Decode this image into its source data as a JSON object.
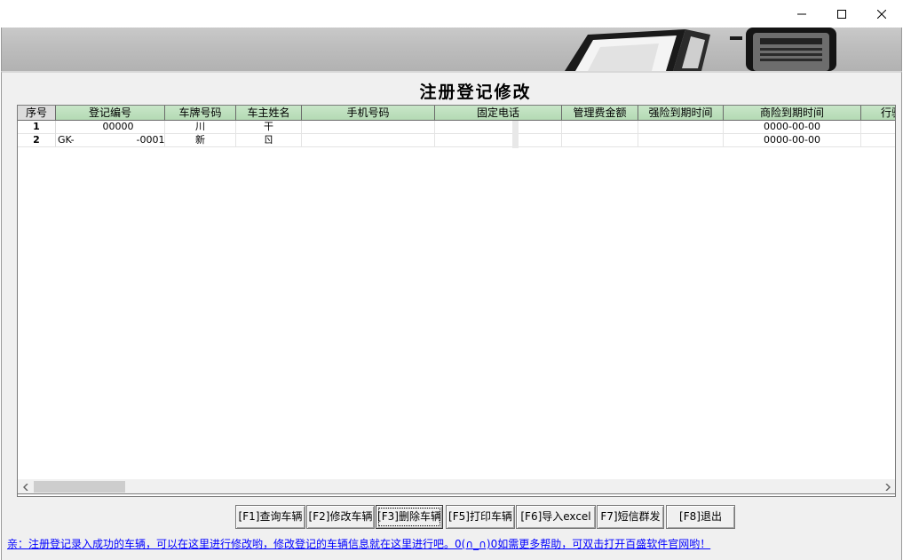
{
  "window": {
    "controls": {
      "minimize_icon": "minimize-icon",
      "maximize_icon": "maximize-icon",
      "close_icon": "close-icon"
    }
  },
  "main": {
    "title": "注册登记修改"
  },
  "table": {
    "columns": [
      "序号",
      "登记编号",
      "车牌号码",
      "车主姓名",
      "手机号码",
      "固定电话",
      "管理费金额",
      "强险到期时间",
      "商险到期时间",
      "行驶"
    ],
    "rows": [
      {
        "seq": "1",
        "reg_no": "00000",
        "plate": "川",
        "owner": "干",
        "mobile": "",
        "phone": "",
        "fee": "",
        "ci_expiry": "",
        "comm_expiry": "0000-00-00",
        "extra": ""
      },
      {
        "seq": "2",
        "reg_no": "GK-                    -0001",
        "plate": "新",
        "owner": "ㄖ",
        "mobile": "",
        "phone": "",
        "fee": "",
        "ci_expiry": "",
        "comm_expiry": "0000-00-00",
        "extra": ""
      }
    ]
  },
  "buttons": {
    "query": "[F1]查询车辆",
    "modify": "[F2]修改车辆",
    "delete": "[F3]删除车辆",
    "print": "[F5]打印车辆",
    "import": "[F6]导入excel",
    "sms": "F7]短信群发",
    "exit": "[F8]退出"
  },
  "status": {
    "text": "亲：注册登记录入成功的车辆，可以在这里进行修改哟，修改登记的车辆信息就在这里进行吧。0(∩_∩)0如需更多帮助，可双击打开百盛软件官网哟！"
  },
  "colors": {
    "header_green": "#b4dab4",
    "panel_bg": "#f0f0f0",
    "status_link": "#0000ff"
  }
}
